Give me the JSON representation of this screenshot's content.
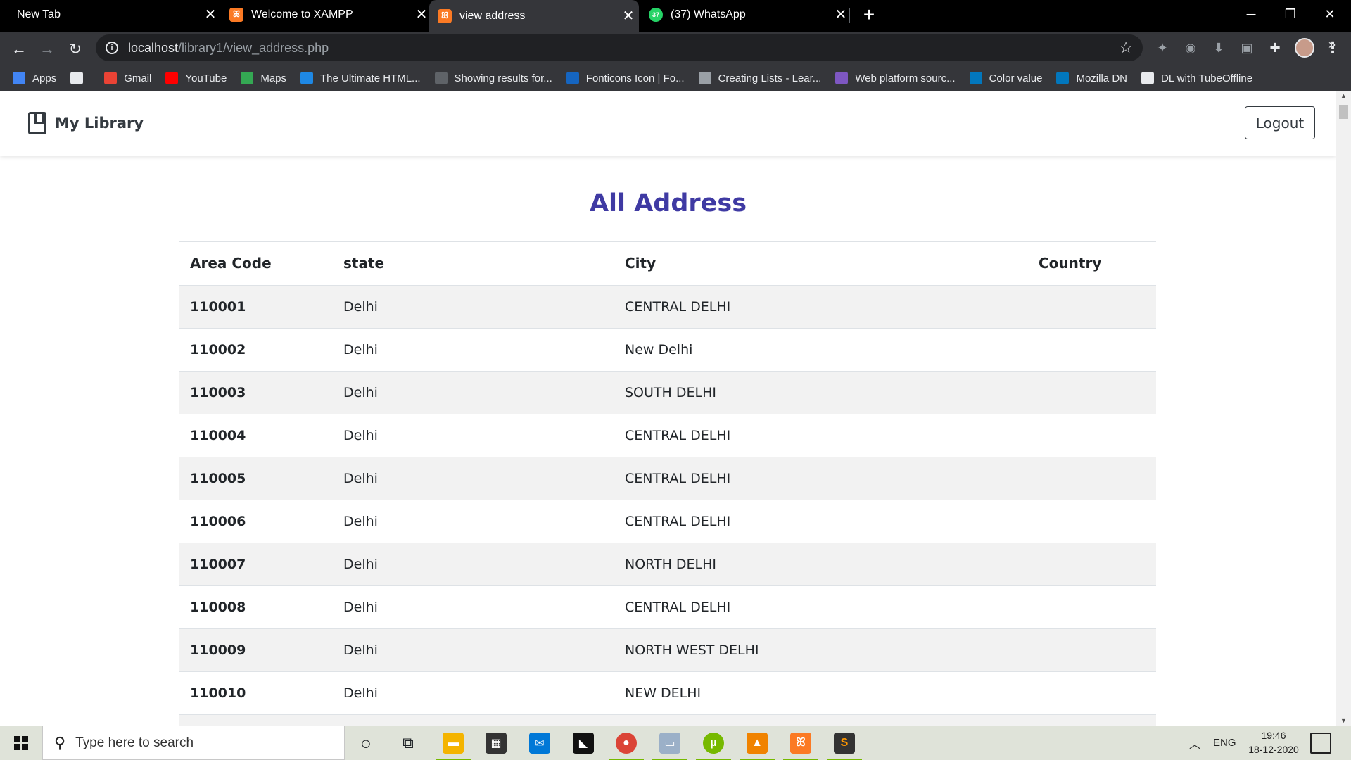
{
  "browser": {
    "tabs": [
      {
        "title": "New Tab",
        "active": false,
        "favicon": "none"
      },
      {
        "title": "Welcome to XAMPP",
        "active": false,
        "favicon": "xampp-icon"
      },
      {
        "title": "view address",
        "active": true,
        "favicon": "xampp-icon"
      },
      {
        "title": "(37) WhatsApp",
        "active": false,
        "favicon": "whatsapp-icon"
      }
    ],
    "url_host": "localhost",
    "url_path": "/library1/view_address.php",
    "bookmarks": [
      {
        "label": "Apps",
        "icon": "apps-grid-icon",
        "color": "#4285f4"
      },
      {
        "label": "",
        "icon": "globe-icon",
        "color": "#e8eaed"
      },
      {
        "label": "Gmail",
        "icon": "gmail-icon",
        "color": "#ea4335"
      },
      {
        "label": "YouTube",
        "icon": "youtube-icon",
        "color": "#ff0000"
      },
      {
        "label": "Maps",
        "icon": "maps-icon",
        "color": "#34a853"
      },
      {
        "label": "The Ultimate HTML...",
        "icon": "html-icon",
        "color": "#1e88e5"
      },
      {
        "label": "Showing results for...",
        "icon": "nu-icon",
        "color": "#5f6368"
      },
      {
        "label": "Fonticons Icon | Fo...",
        "icon": "flag-icon",
        "color": "#1565c0"
      },
      {
        "label": "Creating Lists - Lear...",
        "icon": "code-icon",
        "color": "#9aa0a6"
      },
      {
        "label": "Web platform sourc...",
        "icon": "webplatform-icon",
        "color": "#7e57c2"
      },
      {
        "label": "Color value",
        "icon": "mdn-icon",
        "color": "#0277bd"
      },
      {
        "label": "Mozilla DN",
        "icon": "mdn-icon",
        "color": "#0277bd"
      },
      {
        "label": "DL with TubeOffline",
        "icon": "globe-icon",
        "color": "#e8eaed"
      }
    ]
  },
  "app": {
    "brand": "My Library",
    "logout_label": "Logout",
    "heading": "All Address",
    "heading_color": "#3f3aa3",
    "table": {
      "headers": [
        "Area Code",
        "state",
        "City",
        "Country"
      ],
      "rows": [
        {
          "code": "110001",
          "state": "Delhi",
          "city": "CENTRAL DELHI",
          "country": ""
        },
        {
          "code": "110002",
          "state": "Delhi",
          "city": "New Delhi",
          "country": ""
        },
        {
          "code": "110003",
          "state": "Delhi",
          "city": "SOUTH DELHI",
          "country": ""
        },
        {
          "code": "110004",
          "state": "Delhi",
          "city": "CENTRAL DELHI",
          "country": ""
        },
        {
          "code": "110005",
          "state": "Delhi",
          "city": "CENTRAL DELHI",
          "country": ""
        },
        {
          "code": "110006",
          "state": "Delhi",
          "city": "CENTRAL DELHI",
          "country": ""
        },
        {
          "code": "110007",
          "state": "Delhi",
          "city": "NORTH DELHI",
          "country": ""
        },
        {
          "code": "110008",
          "state": "Delhi",
          "city": "CENTRAL DELHI",
          "country": ""
        },
        {
          "code": "110009",
          "state": "Delhi",
          "city": "NORTH WEST DELHI",
          "country": ""
        },
        {
          "code": "110010",
          "state": "Delhi",
          "city": "NEW DELHI",
          "country": ""
        },
        {
          "code": "",
          "state": "",
          "city": "",
          "country": ""
        }
      ]
    }
  },
  "taskbar": {
    "search_placeholder": "Type here to search",
    "language": "ENG",
    "time": "19:46",
    "date": "18-12-2020"
  }
}
